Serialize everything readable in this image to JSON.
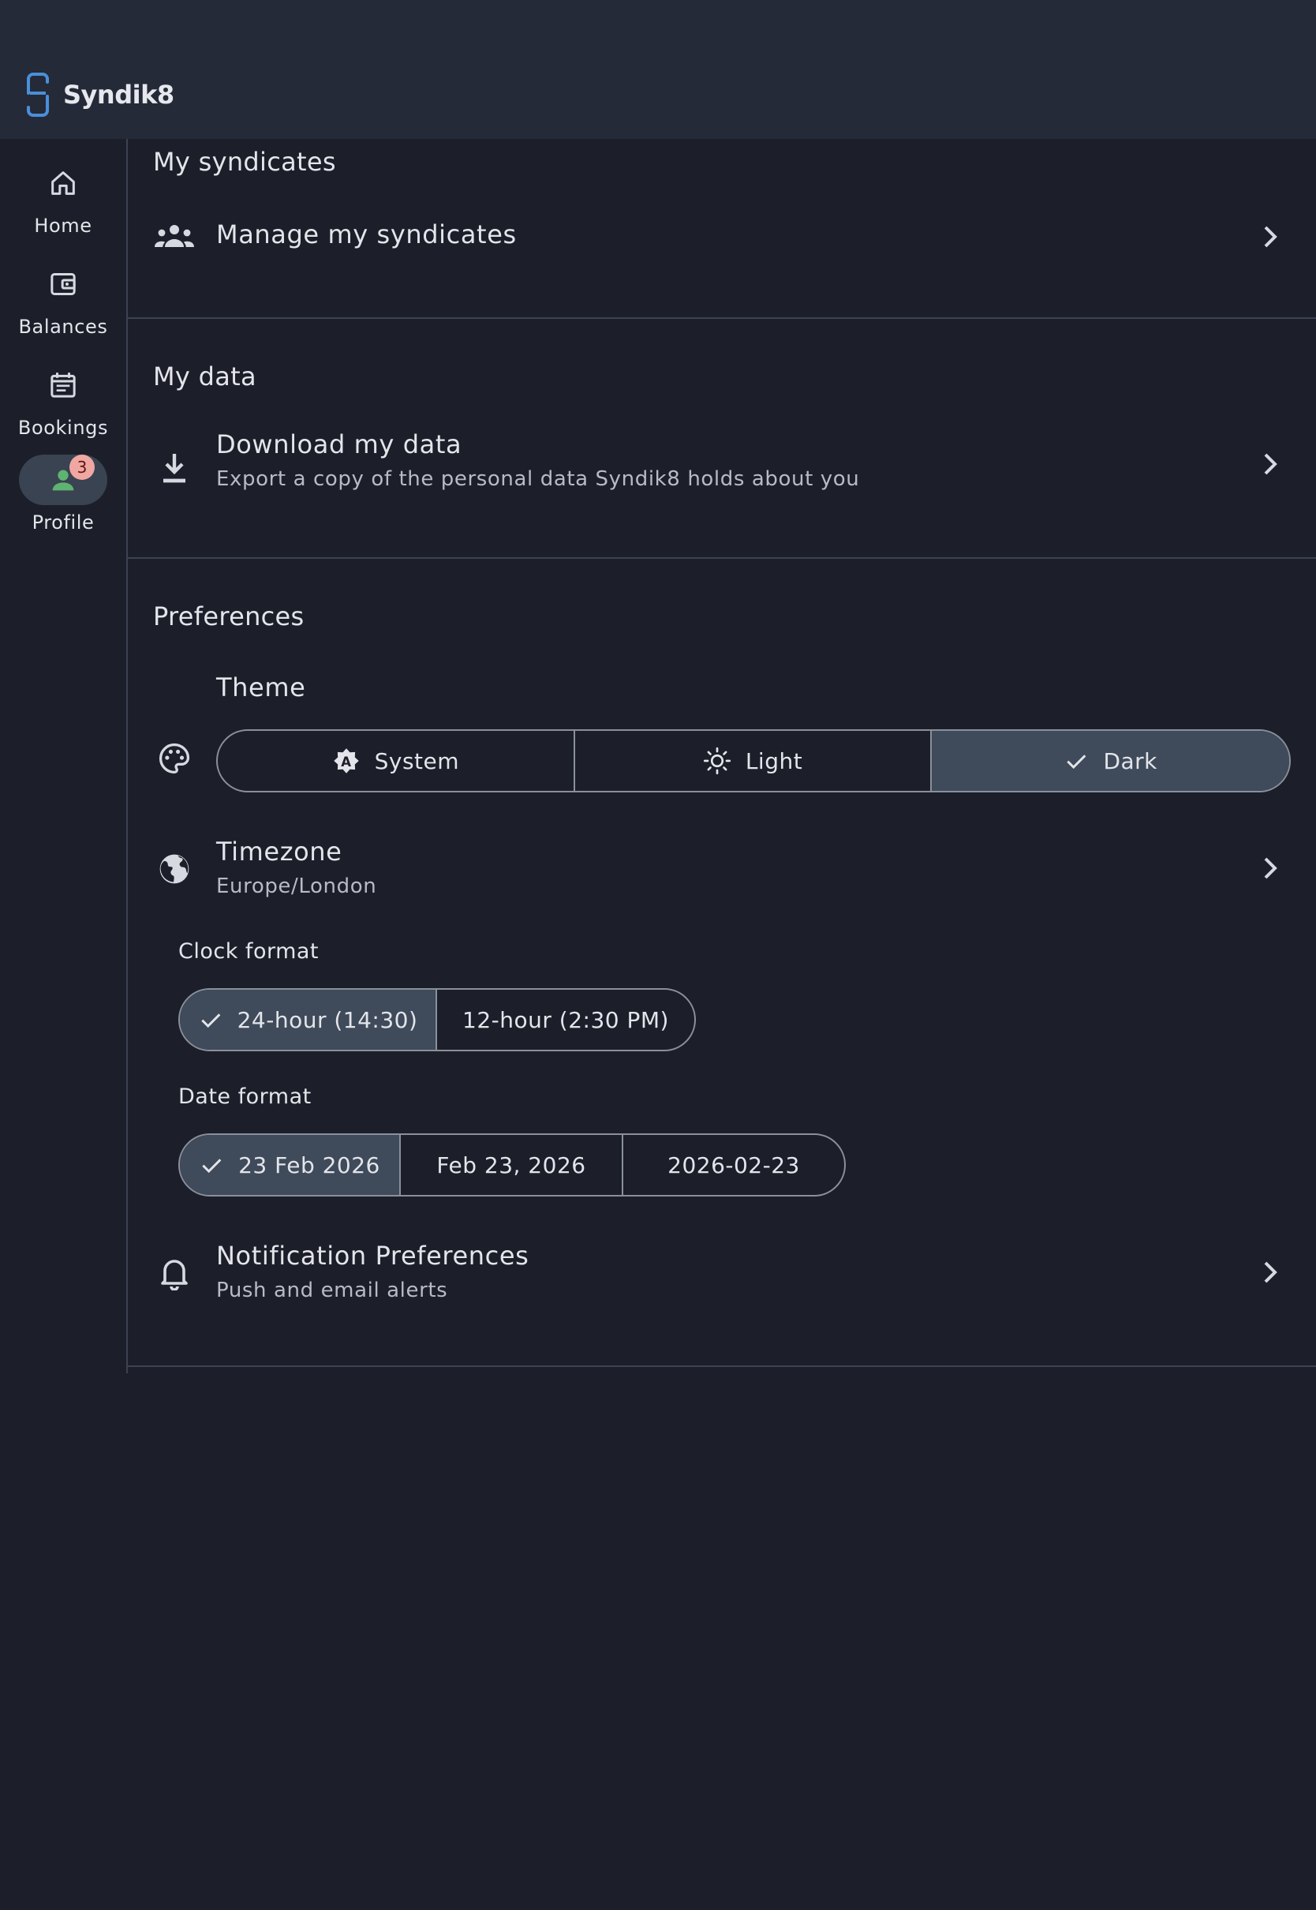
{
  "app": {
    "name": "Syndik8"
  },
  "rail": {
    "items": [
      {
        "label": "Home",
        "icon": "home-icon"
      },
      {
        "label": "Balances",
        "icon": "wallet-icon"
      },
      {
        "label": "Bookings",
        "icon": "calendar-icon"
      },
      {
        "label": "Profile",
        "icon": "person-icon",
        "badge": "3",
        "active": true
      }
    ]
  },
  "sections": {
    "syndicates": {
      "title": "My syndicates",
      "manage": {
        "title": "Manage my syndicates",
        "icon": "group-icon"
      }
    },
    "data": {
      "title": "My data",
      "download": {
        "title": "Download my data",
        "subtitle": "Export a copy of the personal data Syndik8 holds about you",
        "icon": "download-icon"
      }
    },
    "preferences": {
      "title": "Preferences",
      "theme": {
        "title": "Theme",
        "icon": "palette-icon",
        "options": [
          {
            "label": "System",
            "icon": "auto-brightness-icon"
          },
          {
            "label": "Light",
            "icon": "sun-icon"
          },
          {
            "label": "Dark",
            "icon": "check-icon"
          }
        ],
        "selected": "Dark"
      },
      "timezone": {
        "title": "Timezone",
        "value": "Europe/London",
        "icon": "globe-icon"
      },
      "clock": {
        "label": "Clock format",
        "options": [
          "24-hour (14:30)",
          "12-hour (2:30 PM)"
        ],
        "selected": "24-hour (14:30)"
      },
      "date": {
        "label": "Date format",
        "options": [
          "23 Feb 2026",
          "Feb 23, 2026",
          "2026-02-23"
        ],
        "selected": "23 Feb 2026"
      },
      "notifications": {
        "title": "Notification Preferences",
        "subtitle": "Push and email alerts",
        "icon": "bell-icon"
      }
    }
  },
  "colors": {
    "background": "#1c1f29",
    "topbar": "#242a38",
    "selected_segment": "#3f4a5a",
    "logo_accent": "#4a8fd9",
    "badge": "#f1a7a1",
    "profile_icon": "#5fb370"
  }
}
